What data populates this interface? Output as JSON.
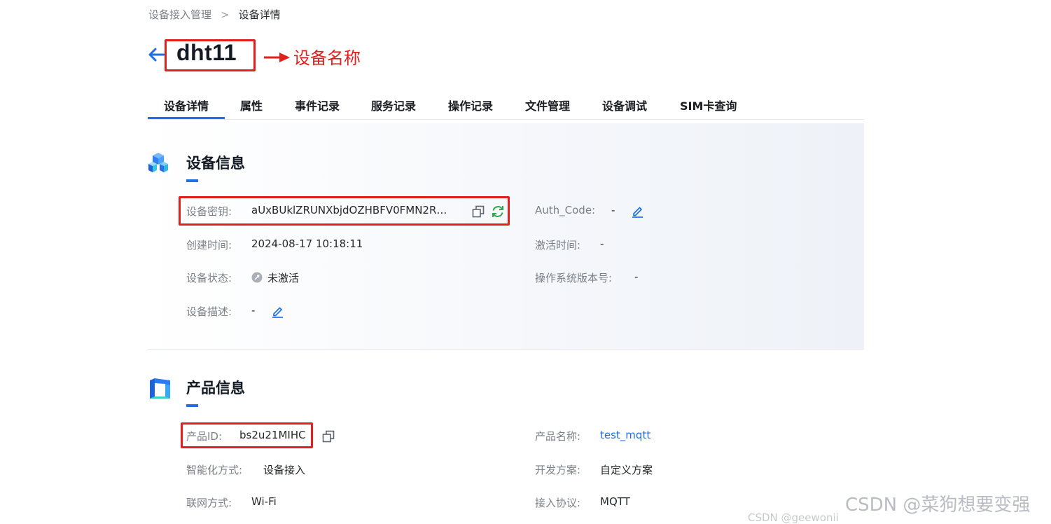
{
  "breadcrumb": {
    "parent": "设备接入管理",
    "separator": ">",
    "current": "设备详情"
  },
  "header": {
    "title": "dht11",
    "annotation": "设备名称"
  },
  "tabs": [
    {
      "label": "设备详情",
      "active": true
    },
    {
      "label": "属性"
    },
    {
      "label": "事件记录"
    },
    {
      "label": "服务记录"
    },
    {
      "label": "操作记录"
    },
    {
      "label": "文件管理"
    },
    {
      "label": "设备调试"
    },
    {
      "label": "SIM卡查询"
    }
  ],
  "device_info": {
    "title": "设备信息",
    "secret_label": "设备密钥:",
    "secret_value": "aUxBUklZRUNXbjdOZHBFV0FMN2R…",
    "auth_code_label": "Auth_Code:",
    "auth_code_value": "-",
    "created_label": "创建时间:",
    "created_value": "2024-08-17 10:18:11",
    "activated_label": "激活时间:",
    "activated_value": "-",
    "status_label": "设备状态:",
    "status_value": "未激活",
    "os_version_label": "操作系统版本号:",
    "os_version_value": "-",
    "desc_label": "设备描述:",
    "desc_value": "-"
  },
  "product_info": {
    "title": "产品信息",
    "id_label": "产品ID:",
    "id_value": "bs2u21MIHC",
    "name_label": "产品名称:",
    "name_value": "test_mqtt",
    "smart_label": "智能化方式:",
    "smart_value": "设备接入",
    "dev_plan_label": "开发方案:",
    "dev_plan_value": "自定义方案",
    "network_label": "联网方式:",
    "network_value": "Wi-Fi",
    "protocol_label": "接入协议:",
    "protocol_value": "MQTT"
  },
  "watermark": {
    "main": "CSDN @菜狗想要变强",
    "sub": "CSDN @geewonii"
  },
  "colors": {
    "accent": "#1f6fe6",
    "annotation_red": "#e0201c",
    "refresh_green": "#2fa84f"
  },
  "icons": [
    "back-arrow-icon",
    "annotation-arrow-icon",
    "cube-icon",
    "product-box-icon",
    "copy-icon",
    "refresh-icon",
    "edit-icon",
    "status-inactive-icon"
  ]
}
